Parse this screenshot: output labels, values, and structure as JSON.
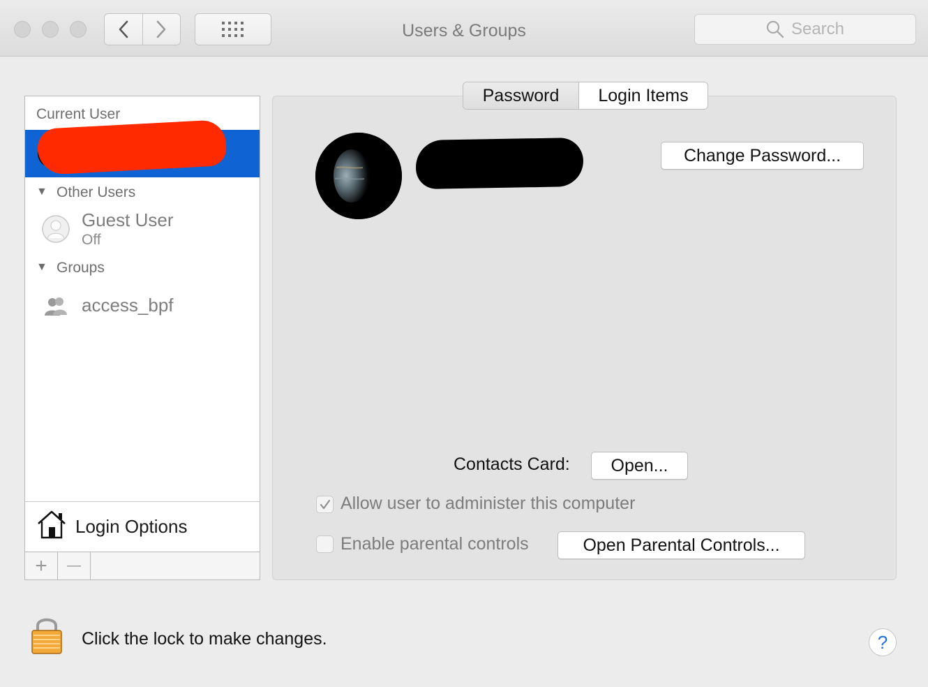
{
  "window": {
    "title": "Users & Groups"
  },
  "toolbar": {
    "back_icon": "chevron-left-icon",
    "forward_icon": "chevron-right-icon",
    "show_all_icon": "grid-icon",
    "search_placeholder": "Search"
  },
  "sidebar": {
    "current_user_heading": "Current User",
    "other_users_heading": "Other Users",
    "guest_user": {
      "name": "Guest User",
      "status": "Off"
    },
    "groups_heading": "Groups",
    "group": {
      "name": "access_bpf"
    },
    "login_options_label": "Login Options",
    "add_label": "+",
    "remove_label": "—",
    "selection_color": "#0f63d3"
  },
  "tabs": [
    {
      "label": "Password",
      "selected": true
    },
    {
      "label": "Login Items",
      "selected": false
    }
  ],
  "user_panel": {
    "change_password_label": "Change Password...",
    "contacts_card_label": "Contacts Card:",
    "open_button_label": "Open...",
    "allow_admin_label": "Allow user to administer this computer",
    "allow_admin_checked": true,
    "parental_controls_label": "Enable parental controls",
    "parental_controls_checked": false,
    "open_parental_controls_label": "Open Parental Controls..."
  },
  "footer": {
    "lock_text": "Click the lock to make changes.",
    "help_label": "?"
  }
}
